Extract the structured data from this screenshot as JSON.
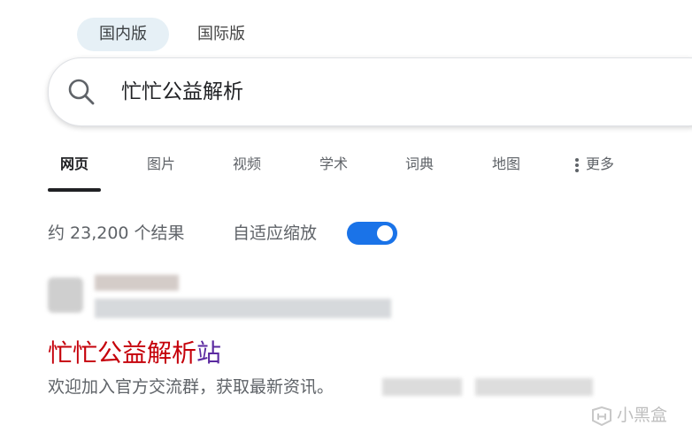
{
  "region_tabs": [
    {
      "label": "国内版",
      "active": true
    },
    {
      "label": "国际版",
      "active": false
    }
  ],
  "search": {
    "query": "忙忙公益解析",
    "icon": "search-icon"
  },
  "nav": {
    "tabs": [
      {
        "label": "网页",
        "active": true
      },
      {
        "label": "图片"
      },
      {
        "label": "视频"
      },
      {
        "label": "学术"
      },
      {
        "label": "词典"
      },
      {
        "label": "地图"
      }
    ],
    "more_label": "更多",
    "more_icon": "kebab-menu-icon"
  },
  "results_info": {
    "count_text": "约 23,200 个结果",
    "adaptive_zoom_label": "自适应缩放",
    "adaptive_zoom_on": true
  },
  "result": {
    "title_red": "忙忙公益解析",
    "title_purple": "站",
    "snippet": "欢迎加入官方交流群，获取最新资讯。"
  },
  "watermark": {
    "text": "小黑盒",
    "icon": "heybox-logo-icon"
  },
  "colors": {
    "accent": "#1a73e8",
    "title_red": "#c5000a",
    "title_visited": "#5b2aa0"
  }
}
